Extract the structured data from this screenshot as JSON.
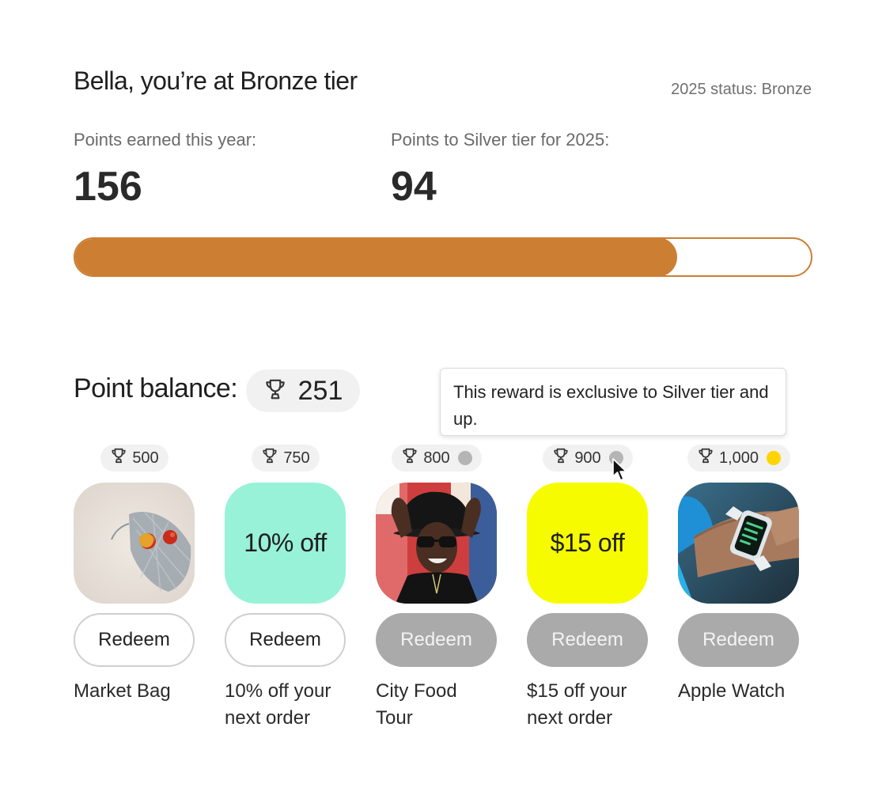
{
  "header": {
    "greeting": "Bella, you’re at Bronze tier",
    "status": "2025 status: Bronze"
  },
  "stats": {
    "earned_label": "Points earned this year:",
    "earned_value": "156",
    "to_next_label": "Points to Silver tier for 2025:",
    "to_next_value": "94"
  },
  "progress": {
    "fraction": 0.82,
    "fill_color": "#cc7e33"
  },
  "balance": {
    "label": "Point balance:",
    "value": "251",
    "icon": "trophy-icon"
  },
  "tooltip": {
    "text": "This reward is exclusive to Silver tier and up."
  },
  "colors": {
    "accent": "#cc7e33",
    "silver_dot": "#b5b5b5",
    "gold_dot": "#ffd400",
    "disabled_button": "#aaaaaa"
  },
  "rewards": [
    {
      "cost": "500",
      "tile_text": "",
      "tile_kind": "photo-bag",
      "button": "Redeem",
      "enabled": true,
      "name": "Market Bag"
    },
    {
      "cost": "750",
      "tile_text": "10% off",
      "tile_kind": "mint",
      "button": "Redeem",
      "enabled": true,
      "name": "10% off your next order"
    },
    {
      "cost": "800",
      "tile_text": "",
      "tile_kind": "photo-person",
      "tier_dot": "silver",
      "button": "Redeem",
      "enabled": false,
      "name": "City Food Tour"
    },
    {
      "cost": "900",
      "tile_text": "$15 off",
      "tile_kind": "yellow",
      "tier_dot": "silver",
      "button": "Redeem",
      "enabled": false,
      "name": "$15 off your next order"
    },
    {
      "cost": "1,000",
      "tile_text": "",
      "tile_kind": "photo-watch",
      "tier_dot": "gold",
      "button": "Redeem",
      "enabled": false,
      "name": "Apple Watch"
    }
  ]
}
